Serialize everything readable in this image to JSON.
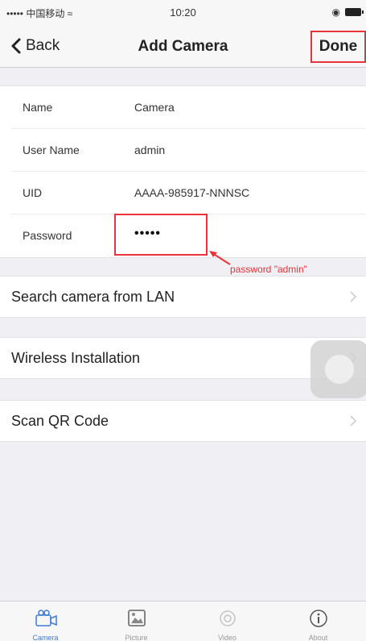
{
  "status_bar": {
    "carrier": "••••• 中国移动 ≈",
    "time": "10:20",
    "battery_icon": "battery-icon"
  },
  "nav": {
    "back_label": "Back",
    "title": "Add Camera",
    "done_label": "Done"
  },
  "form": {
    "rows": [
      {
        "label": "Name",
        "value": "Camera"
      },
      {
        "label": "User Name",
        "value": "admin"
      },
      {
        "label": "UID",
        "value": "AAAA-985917-NNNSC"
      },
      {
        "label": "Password",
        "value": "•••••"
      }
    ],
    "annotation": "password \"admin\""
  },
  "actions": [
    {
      "label": "Search camera from LAN"
    },
    {
      "label": "Wireless Installation"
    },
    {
      "label": "Scan QR Code"
    }
  ],
  "tabs": [
    {
      "label": "Camera",
      "icon": "camera-icon"
    },
    {
      "label": "Picture",
      "icon": "picture-icon"
    },
    {
      "label": "Video",
      "icon": "video-icon"
    },
    {
      "label": "About",
      "icon": "info-icon"
    }
  ],
  "colors": {
    "highlight": "#e8333a",
    "tab_active": "#3b7dd8",
    "background": "#efeff4"
  }
}
